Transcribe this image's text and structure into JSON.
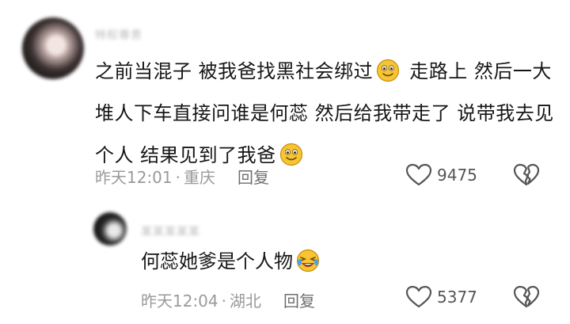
{
  "comment": {
    "username": "特权尊贵",
    "text_part1": "之前当混子 被我爸找黑社会绑过",
    "text_part2": " 走路上 然后一大堆人下车直接问谁是何蕊 然后给我带走了 说带我去见个人 结果见到了我爸",
    "emoji_name": "slight-smile-emoji",
    "time": "昨天12:01",
    "separator": "·",
    "location": "重庆",
    "reply_label": "回复",
    "like_count": "9475"
  },
  "reply": {
    "username": "某某某某某",
    "text": "何蕊她爹是个人物",
    "emoji_name": "laugh-cry-emoji",
    "time": "昨天12:04",
    "separator": "·",
    "location": "湖北",
    "reply_label": "回复",
    "like_count": "5377"
  },
  "colors": {
    "text": "#161616",
    "meta": "#9a9a9a",
    "icon": "#555555",
    "emoji_yellow": "#f7c531"
  }
}
